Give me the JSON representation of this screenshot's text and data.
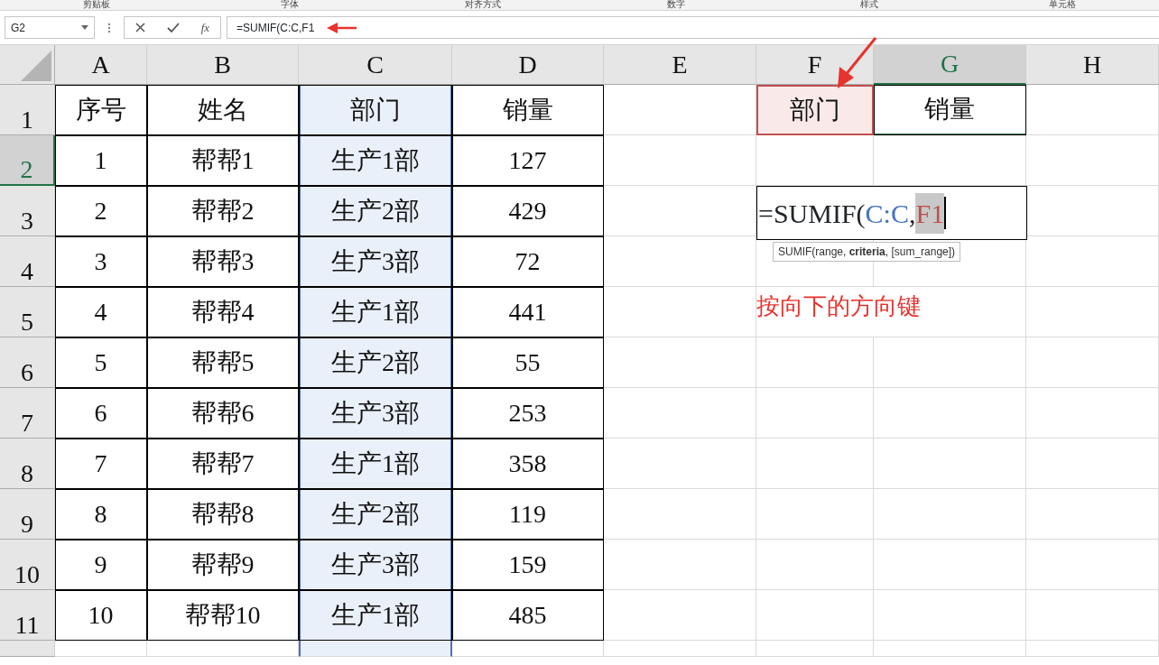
{
  "ribbon_groups": [
    "剪贴板",
    "字体",
    "对齐方式",
    "数字",
    "样式",
    "单元格"
  ],
  "name_box": "G2",
  "formula_bar": {
    "fx_label": "fx",
    "formula": "=SUMIF(C:C,F1"
  },
  "columns": [
    {
      "label": "A",
      "selected": false
    },
    {
      "label": "B",
      "selected": false
    },
    {
      "label": "C",
      "selected": false,
      "color": "#4472c4"
    },
    {
      "label": "D",
      "selected": false
    },
    {
      "label": "E",
      "selected": false
    },
    {
      "label": "F",
      "selected": false
    },
    {
      "label": "G",
      "selected": true
    },
    {
      "label": "H",
      "selected": false
    }
  ],
  "rows": [
    {
      "label": "1",
      "selected": false,
      "cells": [
        "序号",
        "姓名",
        "部门",
        "销量",
        "",
        {
          "text": "部门",
          "color": "#c0504d"
        },
        "销量",
        ""
      ]
    },
    {
      "label": "2",
      "selected": true,
      "cells": [
        "1",
        "帮帮1",
        "生产1部",
        "127",
        "",
        "",
        "",
        ""
      ]
    },
    {
      "label": "3",
      "selected": false,
      "cells": [
        "2",
        "帮帮2",
        "生产2部",
        "429",
        "",
        "",
        "",
        ""
      ]
    },
    {
      "label": "4",
      "selected": false,
      "cells": [
        "3",
        "帮帮3",
        "生产3部",
        "72",
        "",
        "",
        "",
        ""
      ]
    },
    {
      "label": "5",
      "selected": false,
      "cells": [
        "4",
        "帮帮4",
        "生产1部",
        "441",
        "",
        "",
        "",
        ""
      ]
    },
    {
      "label": "6",
      "selected": false,
      "cells": [
        "5",
        "帮帮5",
        "生产2部",
        "55",
        "",
        "",
        "",
        ""
      ]
    },
    {
      "label": "7",
      "selected": false,
      "cells": [
        "6",
        "帮帮6",
        "生产3部",
        "253",
        "",
        "",
        "",
        ""
      ]
    },
    {
      "label": "8",
      "selected": false,
      "cells": [
        "7",
        "帮帮7",
        "生产1部",
        "358",
        "",
        "",
        "",
        ""
      ]
    },
    {
      "label": "9",
      "selected": false,
      "cells": [
        "8",
        "帮帮8",
        "生产2部",
        "119",
        "",
        "",
        "",
        ""
      ]
    },
    {
      "label": "10",
      "selected": false,
      "cells": [
        "9",
        "帮帮9",
        "生产3部",
        "159",
        "",
        "",
        "",
        ""
      ]
    },
    {
      "label": "11",
      "selected": false,
      "cells": [
        "10",
        "帮帮10",
        "生产1部",
        "485",
        "",
        "",
        "",
        ""
      ]
    },
    {
      "selected": false,
      "cells": [
        "",
        "",
        "",
        "",
        "",
        "",
        "",
        ""
      ]
    }
  ],
  "editing_cell": {
    "parts": [
      {
        "text": "=SUMIF(",
        "kind": "plain"
      },
      {
        "text": "C:C",
        "kind": "ref",
        "color": "#4472c4"
      },
      {
        "text": ",",
        "kind": "plain"
      },
      {
        "text": "F1",
        "kind": "ref",
        "color": "#c0504d",
        "highlighted": true
      }
    ],
    "tooltip": "SUMIF(range, **criteria**, [sum_range])"
  },
  "annotation": "按向下的方向键"
}
